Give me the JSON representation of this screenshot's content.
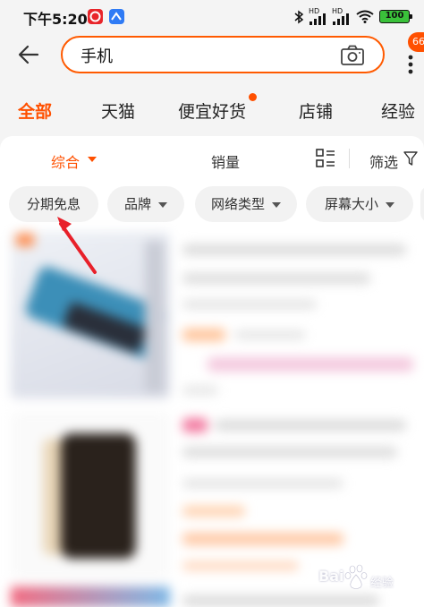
{
  "status_bar": {
    "time": "下午5:20",
    "signal_1": "HD",
    "signal_2": "HD",
    "battery": "100"
  },
  "header": {
    "back_icon": "arrow-left-icon",
    "search_value": "手机",
    "camera_icon": "camera-icon",
    "notification_count": "66",
    "more_icon": "more-vertical-icon"
  },
  "category_tabs": [
    {
      "label": "全部",
      "active": true
    },
    {
      "label": "天猫"
    },
    {
      "label": "便宜好货"
    },
    {
      "label": "店铺"
    },
    {
      "label": "经验"
    }
  ],
  "sort_bar": {
    "comprehensive": "综合",
    "sales": "销量",
    "filter": "筛选"
  },
  "chips": [
    {
      "label": "分期免息"
    },
    {
      "label": "品牌"
    },
    {
      "label": "网络类型"
    },
    {
      "label": "屏幕大小"
    }
  ],
  "watermark": {
    "text": "Bai",
    "sub": "经验"
  },
  "colors": {
    "accent": "#ff5000",
    "annotation_arrow": "#e8202a"
  }
}
